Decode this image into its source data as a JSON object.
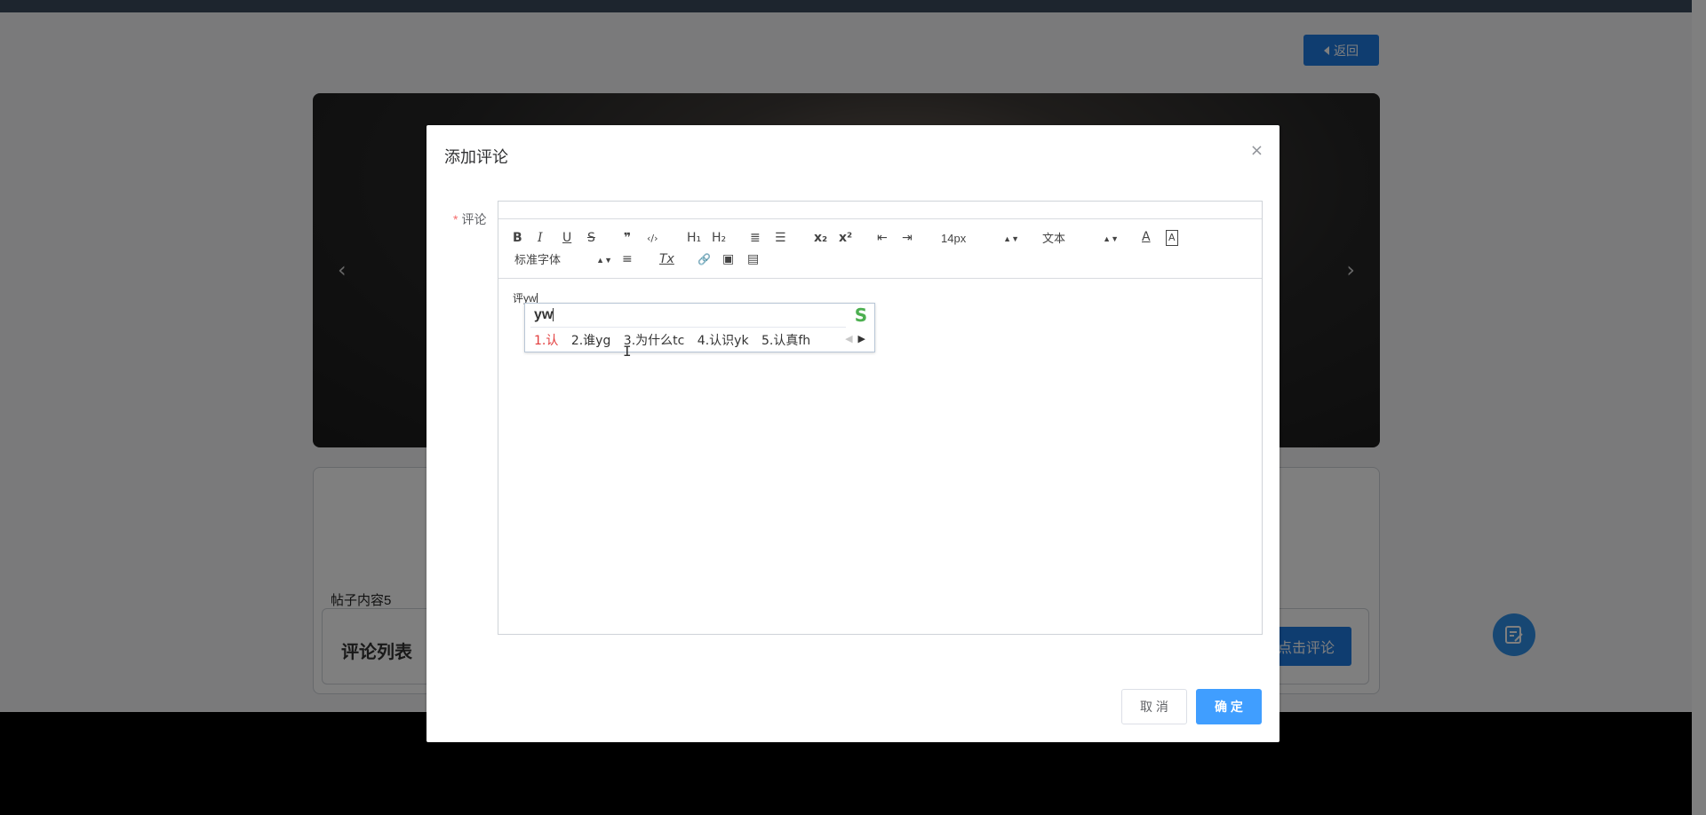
{
  "background": {
    "back_button": "返回",
    "post_content": "帖子内容5",
    "comment_list_title": "评论列表",
    "comment_button": "点击评论",
    "carousel_prev": "‹",
    "carousel_next": "›"
  },
  "dialog": {
    "title": "添加评论",
    "close_glyph": "×",
    "field_required_mark": "*",
    "field_label": "评论",
    "toolbar": {
      "bold": "B",
      "italic": "I",
      "underline": "U",
      "strike": "S",
      "blockquote": "❞",
      "code": "‹/›",
      "h1": "H₁",
      "h2": "H₂",
      "ordered_list": "≣",
      "bullet_list": "☰",
      "subscript": "x₂",
      "superscript": "x²",
      "outdent": "⇤",
      "indent": "⇥",
      "size_select": "14px",
      "header_select": "文本",
      "font_color": "A",
      "background_color": "A",
      "font_select": "标准字体",
      "align": "≡",
      "clean": "Tx",
      "link": "🔗",
      "image": "▣",
      "video": "▤"
    },
    "editor_text": "评yw",
    "cancel": "取 消",
    "confirm": "确 定"
  },
  "ime": {
    "input": "yw",
    "logo": "S",
    "candidates": [
      "1.认",
      "2.谁yg",
      "3.为什么tc",
      "4.认识yk",
      "5.认真fh"
    ],
    "prev": "◀",
    "next": "▶"
  }
}
